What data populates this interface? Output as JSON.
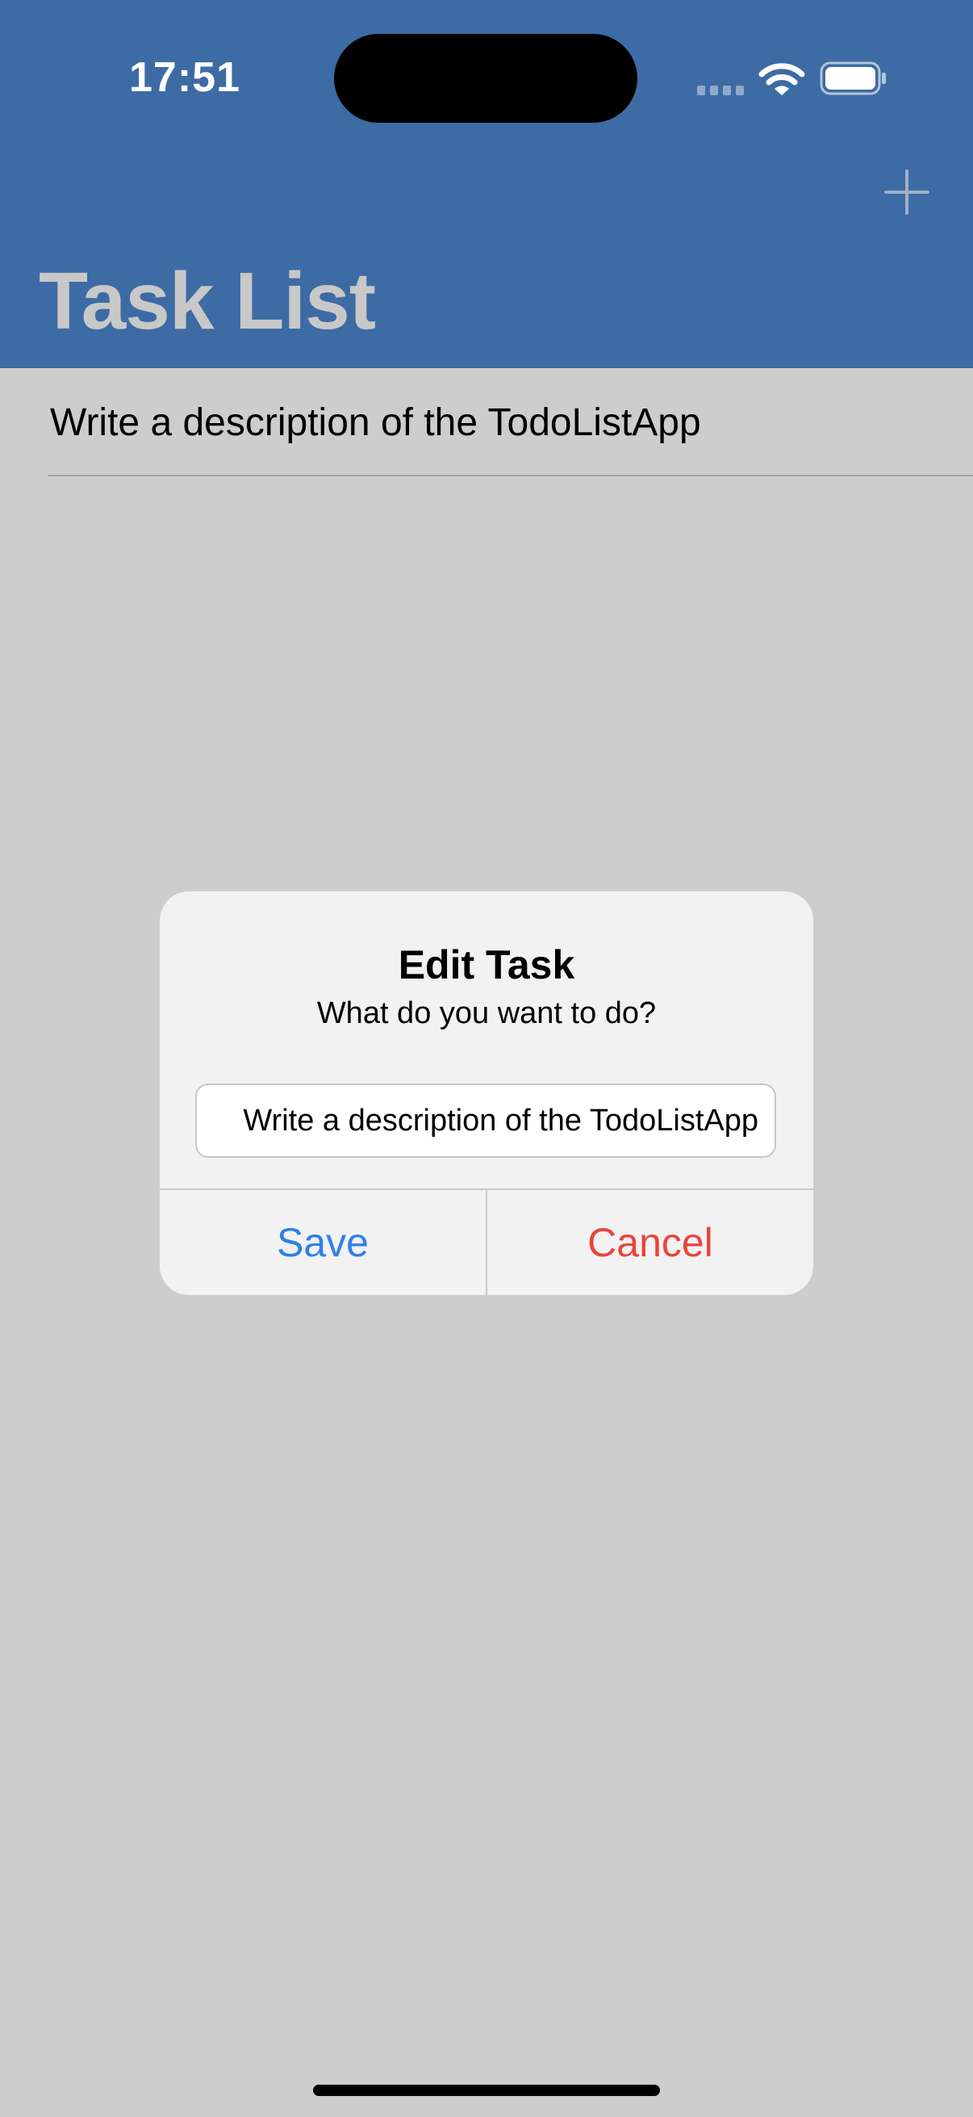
{
  "status_bar": {
    "time": "17:51"
  },
  "nav_bar": {
    "title": "Task List",
    "add_icon": "plus-icon",
    "background_color": "#3d6ba4"
  },
  "task_list": {
    "items": [
      {
        "label": "Write a description of the TodoListApp"
      }
    ]
  },
  "alert": {
    "title": "Edit Task",
    "message": "What do you want to do?",
    "input_value": "Write a description of the TodoListApp",
    "save_label": "Save",
    "cancel_label": "Cancel",
    "save_color": "#2f80e8",
    "cancel_color": "#e8453c"
  }
}
